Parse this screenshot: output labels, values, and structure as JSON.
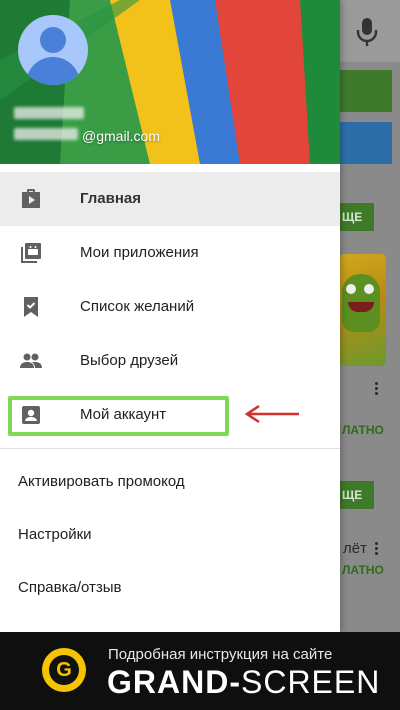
{
  "account": {
    "email_suffix": "@gmail.com"
  },
  "menu_primary": [
    {
      "label": "Главная",
      "icon": "shop-bag-icon",
      "active": true
    },
    {
      "label": "Мои приложения",
      "icon": "my-apps-icon",
      "active": false
    },
    {
      "label": "Список желаний",
      "icon": "wishlist-bookmark-icon",
      "active": false
    },
    {
      "label": "Выбор друзей",
      "icon": "people-icon",
      "active": false
    },
    {
      "label": "Мой аккаунт",
      "icon": "account-box-icon",
      "active": false
    }
  ],
  "menu_secondary": [
    {
      "label": "Активировать промокод"
    },
    {
      "label": "Настройки"
    },
    {
      "label": "Справка/отзыв"
    }
  ],
  "background": {
    "install_label": "ЩЕ",
    "free_label": "ЛАТНО",
    "partial_title": "лёт"
  },
  "banner": {
    "subtitle": "Подробная инструкция на сайте",
    "brand_bold": "GRAND-",
    "brand_thin": "SCREEN",
    "logo_letter": "G"
  },
  "colors": {
    "highlight": "#7ed957",
    "arrow": "#d32f2f",
    "active_bg": "#ececec"
  }
}
